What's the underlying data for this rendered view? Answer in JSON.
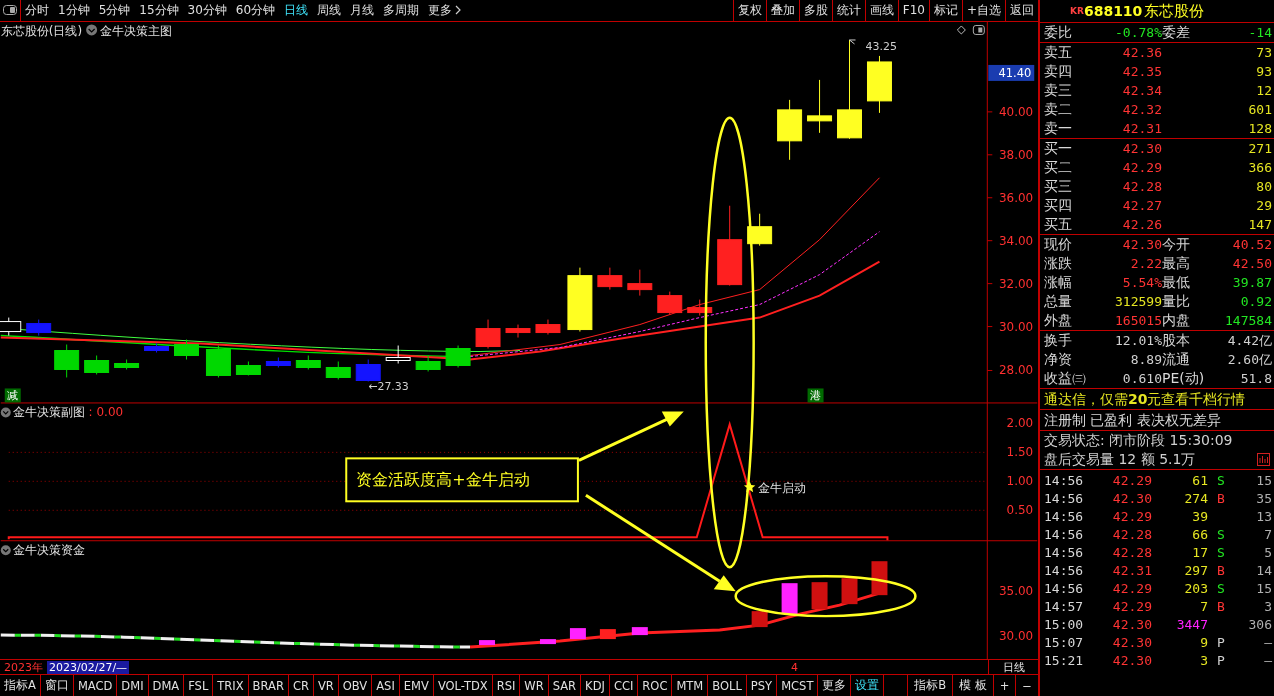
{
  "toolbar": {
    "periods": [
      {
        "label": "分时",
        "selected": false,
        "kind": "plain"
      },
      {
        "label": "1分钟",
        "selected": false,
        "kind": "plain"
      },
      {
        "label": "5分钟",
        "selected": false,
        "kind": "plain"
      },
      {
        "label": "15分钟",
        "selected": false,
        "kind": "plain"
      },
      {
        "label": "30分钟",
        "selected": false,
        "kind": "plain"
      },
      {
        "label": "60分钟",
        "selected": false,
        "kind": "plain"
      },
      {
        "label": "日线",
        "selected": true,
        "kind": "plain"
      },
      {
        "label": "周线",
        "selected": false,
        "kind": "plain"
      },
      {
        "label": "月线",
        "selected": false,
        "kind": "plain"
      },
      {
        "label": "多周期",
        "selected": false,
        "kind": "plain"
      },
      {
        "label": "更多",
        "selected": false,
        "kind": "menu"
      }
    ],
    "actions": [
      "复权",
      "叠加",
      "多股",
      "统计",
      "画线",
      "F10",
      "标记",
      "+自选",
      "返回"
    ]
  },
  "main_chart": {
    "title": "东芯股份(日线)",
    "indicator": "金牛决策主图",
    "y_ticks": [
      "40.00",
      "38.00",
      "36.00",
      "34.00",
      "32.00",
      "30.00",
      "28.00"
    ],
    "price_tag": "41.40",
    "high_label": "43.25",
    "low_label": "←27.33",
    "markers": [
      "减",
      "港"
    ]
  },
  "sub_chart": {
    "title": "金牛决策副图",
    "value": ": 0.00",
    "y_ticks": [
      "2.00",
      "1.50",
      "1.00",
      "0.50"
    ],
    "signal_label": "金牛启动",
    "callout": "资金活跃度高+金牛启动"
  },
  "fund_chart": {
    "title": "金牛决策资金",
    "y_ticks": [
      "35.00",
      "30.00"
    ]
  },
  "date_bar": {
    "year": "2023年",
    "date": "2023/02/27/—",
    "marker": "4",
    "period": "日线"
  },
  "indicator_tabs": [
    {
      "label": "指标A",
      "kind": "plain"
    },
    {
      "label": "窗口",
      "kind": "plain"
    },
    {
      "label": "MACD",
      "kind": "plain"
    },
    {
      "label": "DMI",
      "kind": "plain"
    },
    {
      "label": "DMA",
      "kind": "plain"
    },
    {
      "label": "FSL",
      "kind": "plain"
    },
    {
      "label": "TRIX",
      "kind": "plain"
    },
    {
      "label": "BRAR",
      "kind": "plain"
    },
    {
      "label": "CR",
      "kind": "plain"
    },
    {
      "label": "VR",
      "kind": "plain"
    },
    {
      "label": "OBV",
      "kind": "plain"
    },
    {
      "label": "ASI",
      "kind": "plain"
    },
    {
      "label": "EMV",
      "kind": "plain"
    },
    {
      "label": "VOL-TDX",
      "kind": "plain"
    },
    {
      "label": "RSI",
      "kind": "plain"
    },
    {
      "label": "WR",
      "kind": "plain"
    },
    {
      "label": "SAR",
      "kind": "plain"
    },
    {
      "label": "KDJ",
      "kind": "plain"
    },
    {
      "label": "CCI",
      "kind": "plain"
    },
    {
      "label": "ROC",
      "kind": "plain"
    },
    {
      "label": "MTM",
      "kind": "plain"
    },
    {
      "label": "BOLL",
      "kind": "plain"
    },
    {
      "label": "PSY",
      "kind": "plain"
    },
    {
      "label": "MCST",
      "kind": "plain"
    },
    {
      "label": "更多",
      "kind": "plain"
    },
    {
      "label": "设置",
      "kind": "accent"
    }
  ],
  "tab_tools": [
    "指标B",
    "模 板",
    "+",
    "−"
  ],
  "quote": {
    "badge": "KR",
    "code": "688110",
    "name": "东芯股份",
    "ratio": [
      {
        "label": "委比",
        "value": "-0.78%",
        "color": "#22e622"
      },
      {
        "label": "委差",
        "value": "-14",
        "color": "#22e622"
      }
    ],
    "asks": [
      {
        "label": "卖五",
        "price": "42.36",
        "volume": "73"
      },
      {
        "label": "卖四",
        "price": "42.35",
        "volume": "93"
      },
      {
        "label": "卖三",
        "price": "42.34",
        "volume": "12"
      },
      {
        "label": "卖二",
        "price": "42.32",
        "volume": "601"
      },
      {
        "label": "卖一",
        "price": "42.31",
        "volume": "128"
      }
    ],
    "bids": [
      {
        "label": "买一",
        "price": "42.30",
        "volume": "271"
      },
      {
        "label": "买二",
        "price": "42.29",
        "volume": "366"
      },
      {
        "label": "买三",
        "price": "42.28",
        "volume": "80"
      },
      {
        "label": "买四",
        "price": "42.27",
        "volume": "29"
      },
      {
        "label": "买五",
        "price": "42.26",
        "volume": "147"
      }
    ],
    "stats": [
      {
        "label": "现价",
        "value": "42.30",
        "color": "#ff3434"
      },
      {
        "label": "今开",
        "value": "40.52",
        "color": "#ff3434"
      },
      {
        "label": "涨跌",
        "value": "2.22",
        "color": "#ff3434"
      },
      {
        "label": "最高",
        "value": "42.50",
        "color": "#ff3434"
      },
      {
        "label": "涨幅",
        "value": "5.54%",
        "color": "#ff3434"
      },
      {
        "label": "最低",
        "value": "39.87",
        "color": "#22e622"
      },
      {
        "label": "总量",
        "value": "312599",
        "color": "#e6e622"
      },
      {
        "label": "量比",
        "value": "0.92",
        "color": "#22e622"
      },
      {
        "label": "外盘",
        "value": "165015",
        "color": "#ff3434"
      },
      {
        "label": "内盘",
        "value": "147584",
        "color": "#22e622"
      }
    ],
    "fundamentals": [
      {
        "label": "换手",
        "value": "12.01%"
      },
      {
        "label": "股本",
        "value": "4.42亿"
      },
      {
        "label": "净资",
        "value": "8.89"
      },
      {
        "label": "流通",
        "value": "2.60亿"
      },
      {
        "label": "收益㈢",
        "value": "0.610"
      },
      {
        "label": "PE(动)",
        "value": "51.8"
      }
    ],
    "notices": [
      {
        "text": "通达信，仅需**20**元查看千档行情",
        "kind": "promo"
      },
      {
        "text": "注册制 已盈利 表决权无差异",
        "kind": "plain"
      }
    ],
    "trading_state": "交易状态: 闭市阶段 15:30:09",
    "after_hours": "盘后交易量 12 额 5.1万",
    "trades": [
      {
        "time": "14:56",
        "price": "42.29",
        "volume": {
          "text": "61",
          "color": "#e6e622"
        },
        "side": {
          "text": "S",
          "color": "#22e622"
        },
        "count": "15"
      },
      {
        "time": "14:56",
        "price": "42.30",
        "volume": {
          "text": "274",
          "color": "#e6e622"
        },
        "side": {
          "text": "B",
          "color": "#ff3434"
        },
        "count": "35"
      },
      {
        "time": "14:56",
        "price": "42.29",
        "volume": {
          "text": "39",
          "color": "#e6e622"
        },
        "count": "13"
      },
      {
        "time": "14:56",
        "price": "42.28",
        "volume": {
          "text": "66",
          "color": "#e6e622"
        },
        "side": {
          "text": "S",
          "color": "#22e622"
        },
        "count": "7"
      },
      {
        "time": "14:56",
        "price": "42.28",
        "volume": {
          "text": "17",
          "color": "#e6e622"
        },
        "side": {
          "text": "S",
          "color": "#22e622"
        },
        "count": "5"
      },
      {
        "time": "14:56",
        "price": "42.31",
        "volume": {
          "text": "297",
          "color": "#e6e622"
        },
        "side": {
          "text": "B",
          "color": "#ff3434"
        },
        "count": "14"
      },
      {
        "time": "14:56",
        "price": "42.29",
        "volume": {
          "text": "203",
          "color": "#e6e622"
        },
        "side": {
          "text": "S",
          "color": "#22e622"
        },
        "count": "15"
      },
      {
        "time": "14:57",
        "price": "42.29",
        "volume": {
          "text": "7",
          "color": "#e6e622"
        },
        "side": {
          "text": "B",
          "color": "#ff3434"
        },
        "count": "3"
      },
      {
        "time": "15:00",
        "price": "42.30",
        "volume": {
          "text": "3447",
          "color": "#ff22ff"
        },
        "count": "306"
      },
      {
        "time": "15:07",
        "price": "42.30",
        "volume": {
          "text": "9",
          "color": "#e6e622"
        },
        "side": {
          "text": "P",
          "color": "#d0d0d0"
        },
        "count": "—"
      },
      {
        "time": "15:21",
        "price": "42.30",
        "volume": {
          "text": "3",
          "color": "#e6e622"
        },
        "side": {
          "text": "P",
          "color": "#d0d0d0"
        },
        "count": "—"
      }
    ]
  }
}
